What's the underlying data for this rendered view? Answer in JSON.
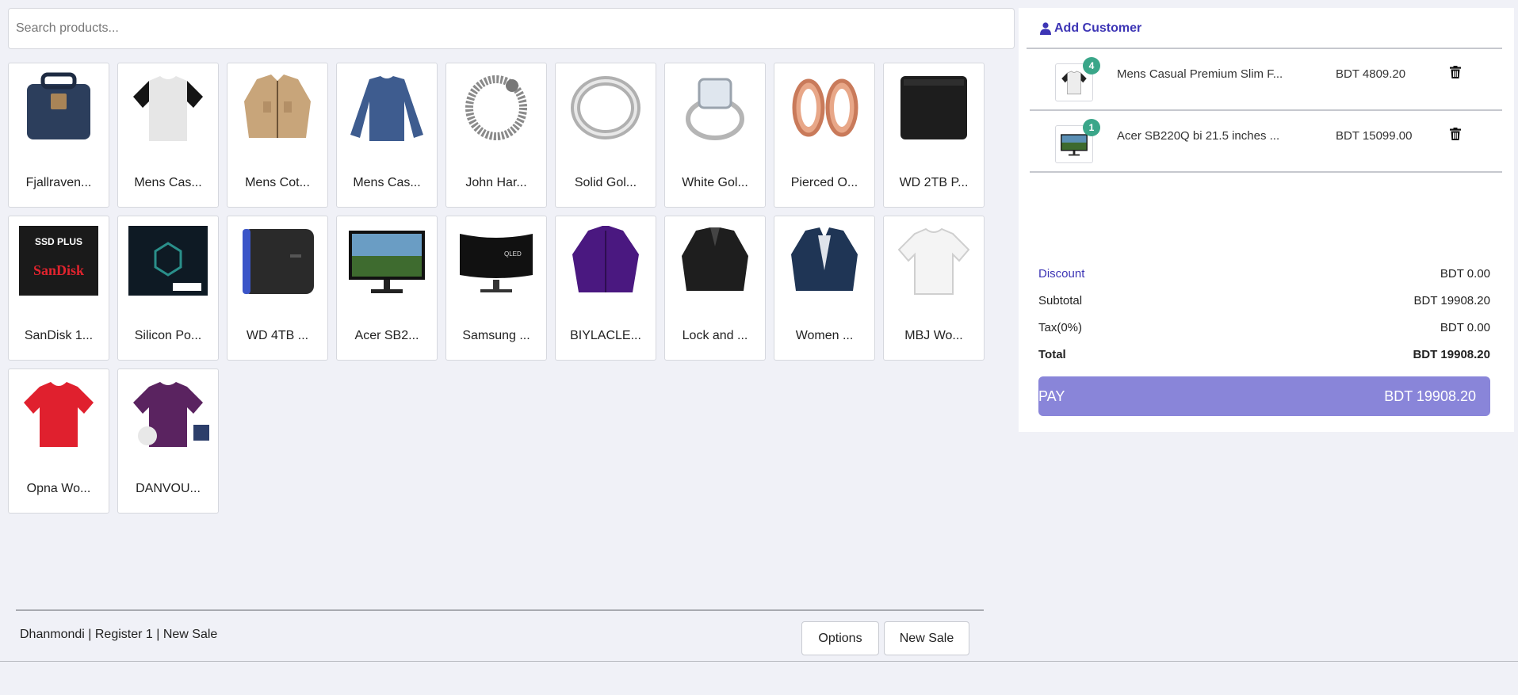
{
  "search": {
    "placeholder": "Search products..."
  },
  "products": [
    {
      "name": "Fjallraven...",
      "thumb": "backpack"
    },
    {
      "name": "Mens Cas...",
      "thumb": "raglan-tee"
    },
    {
      "name": "Mens Cot...",
      "thumb": "jacket"
    },
    {
      "name": "Mens Cas...",
      "thumb": "longsleeve"
    },
    {
      "name": "John Har...",
      "thumb": "bracelet"
    },
    {
      "name": "Solid Gol...",
      "thumb": "ring"
    },
    {
      "name": "White Gol...",
      "thumb": "diamond-ring"
    },
    {
      "name": "Pierced O...",
      "thumb": "plugs"
    },
    {
      "name": "WD 2TB P...",
      "thumb": "hdd-black"
    },
    {
      "name": "SanDisk 1...",
      "thumb": "ssd-sandisk"
    },
    {
      "name": "Silicon Po...",
      "thumb": "ssd-sp"
    },
    {
      "name": "WD 4TB ...",
      "thumb": "hdd-blue"
    },
    {
      "name": "Acer SB2...",
      "thumb": "monitor"
    },
    {
      "name": "Samsung ...",
      "thumb": "curved-monitor"
    },
    {
      "name": "BIYLACLE...",
      "thumb": "purple-coat"
    },
    {
      "name": "Lock and ...",
      "thumb": "leather-jacket"
    },
    {
      "name": "Women ...",
      "thumb": "blazer"
    },
    {
      "name": "MBJ Wo...",
      "thumb": "white-tee"
    },
    {
      "name": "Opna Wo...",
      "thumb": "red-tee"
    },
    {
      "name": "DANVOU...",
      "thumb": "purple-tee"
    }
  ],
  "footer": {
    "status": "Dhanmondi | Register 1 | New Sale",
    "options_label": "Options",
    "new_sale_label": "New Sale"
  },
  "cart": {
    "add_customer_label": "Add Customer",
    "items": [
      {
        "qty": "4",
        "name": "Mens Casual Premium Slim F...",
        "price": "BDT 4809.20",
        "thumb": "raglan-tee"
      },
      {
        "qty": "1",
        "name": "Acer SB220Q bi 21.5 inches ...",
        "price": "BDT 15099.00",
        "thumb": "monitor"
      }
    ]
  },
  "summary": {
    "discount_label": "Discount",
    "discount_value": "BDT 0.00",
    "subtotal_label": "Subtotal",
    "subtotal_value": "BDT 19908.20",
    "tax_label": "Tax(0%)",
    "tax_value": "BDT 0.00",
    "total_label": "Total",
    "total_value": "BDT 19908.20"
  },
  "pay": {
    "label": "PAY",
    "amount": "BDT 19908.20"
  },
  "colors": {
    "accent": "#3d35b5",
    "pay": "#8985d9",
    "badge": "#3aa689",
    "background": "#f0f1f7"
  }
}
